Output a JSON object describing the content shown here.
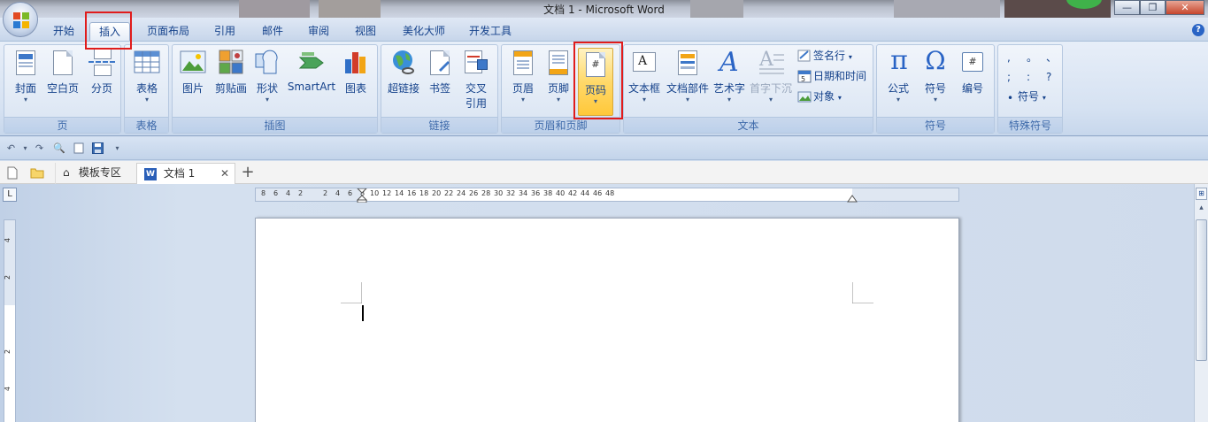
{
  "window": {
    "title": "文档 1 - Microsoft Word"
  },
  "tabs": [
    {
      "label": "开始"
    },
    {
      "label": "插入"
    },
    {
      "label": "页面布局"
    },
    {
      "label": "引用"
    },
    {
      "label": "邮件"
    },
    {
      "label": "审阅"
    },
    {
      "label": "视图"
    },
    {
      "label": "美化大师"
    },
    {
      "label": "开发工具"
    }
  ],
  "ribbon": {
    "groups": {
      "page": "页",
      "table": "表格",
      "illustrations": "插图",
      "links": "链接",
      "header_footer": "页眉和页脚",
      "text": "文本",
      "symbols": "符号",
      "special_symbols": "特殊符号"
    },
    "buttons": {
      "cover": "封面",
      "blank_page": "空白页",
      "page_break": "分页",
      "table": "表格",
      "picture": "图片",
      "clipart": "剪贴画",
      "shapes": "形状",
      "smartart": "SmartArt",
      "chart": "图表",
      "hyperlink": "超链接",
      "bookmark": "书签",
      "cross_ref_1": "交叉",
      "cross_ref_2": "引用",
      "header": "页眉",
      "footer": "页脚",
      "page_number": "页码",
      "textbox": "文本框",
      "quick_parts": "文档部件",
      "wordart": "艺术字",
      "dropcap": "首字下沉",
      "signature": "签名行",
      "datetime": "日期和时间",
      "object": "对象",
      "equation": "公式",
      "symbol": "符号",
      "numbering": "编号",
      "special_symbol": "符号"
    },
    "special_chars": [
      ",",
      "。",
      "、",
      ";",
      ":",
      "?"
    ],
    "equation_glyph": "π",
    "symbol_glyph": "Ω"
  },
  "doc_tabs": {
    "templates": "模板专区",
    "doc": "文档 1",
    "new": "+"
  },
  "ruler": {
    "h_ticks": [
      "8",
      "6",
      "4",
      "2",
      "",
      "2",
      "4",
      "6",
      "8",
      "10",
      "12",
      "14",
      "16",
      "18",
      "20",
      "22",
      "24",
      "26",
      "28",
      "30",
      "32",
      "34",
      "36",
      "38",
      "40",
      "42",
      "44",
      "46",
      "48"
    ],
    "v_ticks": [
      "4",
      "2",
      "",
      "2",
      "4",
      "6"
    ]
  },
  "colors": {
    "highlight": "#ffc83a",
    "annotation_red": "#e01c1c"
  }
}
